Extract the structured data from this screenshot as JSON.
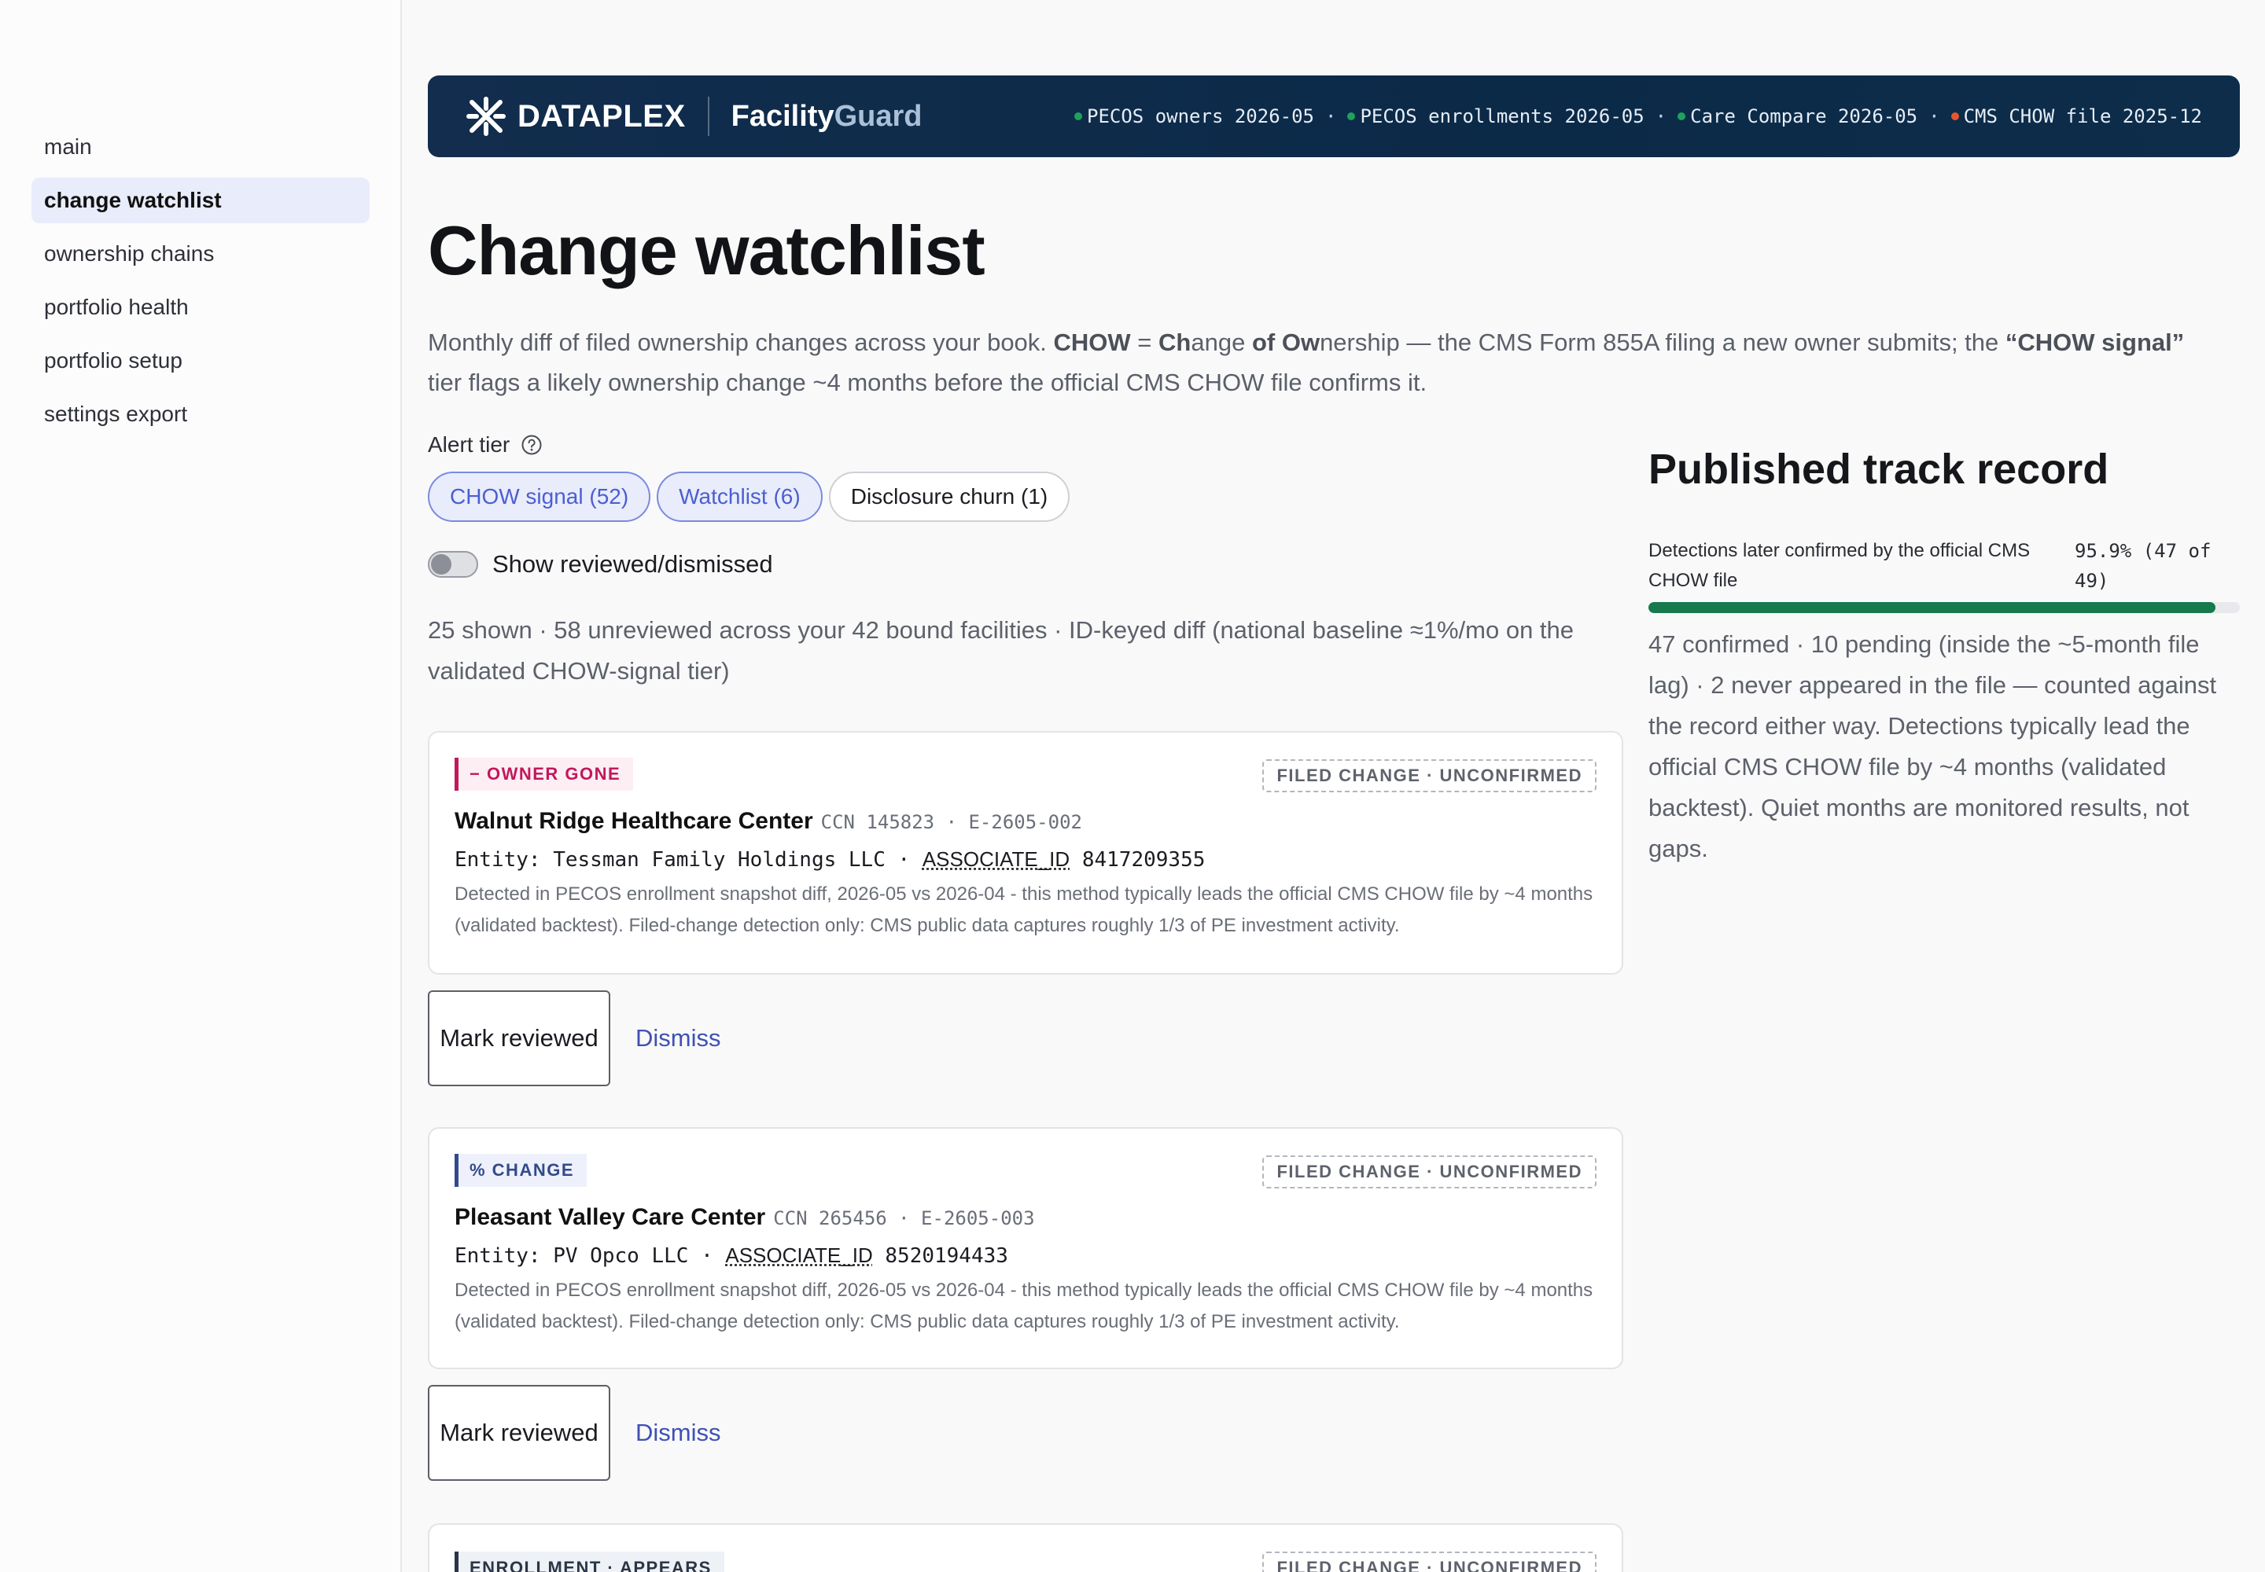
{
  "sidebar": {
    "items": [
      {
        "label": "main",
        "active": false
      },
      {
        "label": "change watchlist",
        "active": true
      },
      {
        "label": "ownership chains",
        "active": false
      },
      {
        "label": "portfolio health",
        "active": false
      },
      {
        "label": "portfolio setup",
        "active": false
      },
      {
        "label": "settings export",
        "active": false
      }
    ]
  },
  "header": {
    "brand": "DATAPLEX",
    "product_main": "Facility",
    "product_accent": "Guard",
    "sources": [
      {
        "label": "PECOS owners 2026-05",
        "status_color": "#1ea25a"
      },
      {
        "label": "PECOS enrollments 2026-05",
        "status_color": "#1ea25a"
      },
      {
        "label": "Care Compare 2026-05",
        "status_color": "#1ea25a"
      },
      {
        "label": "CMS CHOW file 2025-12",
        "status_color": "#e4572e"
      }
    ],
    "separator": "·"
  },
  "page": {
    "title": "Change watchlist",
    "intro_parts": {
      "p1": "Monthly diff of filed ownership changes across your book. ",
      "chow": "CHOW",
      "eq": " = ",
      "ch": "Ch",
      "ange": "ange ",
      "of": "of",
      "sp": " ",
      "ow": "Ow",
      "rest1": "nership — the CMS Form 855A filing a new owner submits; the ",
      "signal": "“CHOW signal”",
      "rest2": " tier flags a likely ownership change ~4 months before the official CMS CHOW file confirms it."
    },
    "alert_tier_label": "Alert tier",
    "chips": [
      {
        "label": "CHOW signal (52)",
        "active": true
      },
      {
        "label": "Watchlist (6)",
        "active": true
      },
      {
        "label": "Disclosure churn (1)",
        "active": false
      }
    ],
    "toggle_label": "Show reviewed/dismissed",
    "summary": "25 shown · 58 unreviewed across your 42 bound facilities · ID-keyed diff (national baseline ≈1%/mo on the validated CHOW-signal tier)"
  },
  "cards": [
    {
      "badge": "− OWNER GONE",
      "status": "FILED CHANGE · UNCONFIRMED",
      "name": "Walnut Ridge Healthcare Center",
      "meta": "CCN 145823 · E-2605-002",
      "entity_prefix": "Entity: Tessman Family Holdings LLC · ",
      "assoc_label": "ASSOCIATE_ID",
      "assoc_id": " 8417209355",
      "detect": "Detected in PECOS enrollment snapshot diff, 2026-05 vs 2026-04 - this method typically leads the official CMS CHOW file by ~4 months (validated backtest). Filed-change detection only: CMS public data captures roughly 1/3 of PE investment activity.",
      "review_label": "Mark reviewed",
      "dismiss_label": "Dismiss"
    },
    {
      "badge": "% CHANGE",
      "status": "FILED CHANGE · UNCONFIRMED",
      "name": "Pleasant Valley Care Center",
      "meta": "CCN 265456 · E-2605-003",
      "entity_prefix": "Entity: PV Opco LLC · ",
      "assoc_label": "ASSOCIATE_ID",
      "assoc_id": " 8520194433",
      "detect": "Detected in PECOS enrollment snapshot diff, 2026-05 vs 2026-04 - this method typically leads the official CMS CHOW file by ~4 months (validated backtest). Filed-change detection only: CMS public data captures roughly 1/3 of PE investment activity.",
      "review_label": "Mark reviewed",
      "dismiss_label": "Dismiss"
    },
    {
      "badge": "ENROLLMENT · APPEARS",
      "status": "FILED CHANGE · UNCONFIRMED"
    }
  ],
  "track_record": {
    "title": "Published track record",
    "metric_label": "Detections later confirmed by the official CMS CHOW file",
    "metric_value": "95.9% (47 of 49)",
    "confirmed_fraction": 0.959,
    "bar_color": "#157a4c",
    "note": "47 confirmed · 10 pending (inside the ~5-month file lag) · 2 never appeared in the file — counted against the record either way. Detections typically lead the official CMS CHOW file by ~4 months (validated backtest). Quiet months are monitored results, not gaps."
  }
}
